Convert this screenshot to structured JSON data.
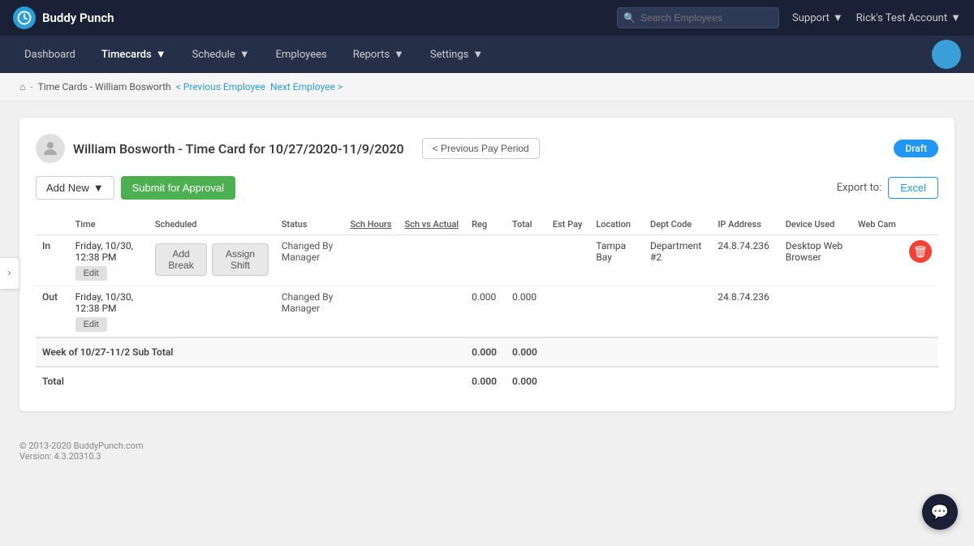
{
  "topbar": {
    "logo_text": "Buddy Punch",
    "search_placeholder": "Search Employees",
    "support_label": "Support",
    "account_name": "Rick's Test Account"
  },
  "nav": {
    "items": [
      {
        "id": "dashboard",
        "label": "Dashboard",
        "active": false,
        "has_dropdown": false
      },
      {
        "id": "timecards",
        "label": "Timecards",
        "active": true,
        "has_dropdown": true
      },
      {
        "id": "schedule",
        "label": "Schedule",
        "active": false,
        "has_dropdown": true
      },
      {
        "id": "employees",
        "label": "Employees",
        "active": false,
        "has_dropdown": false
      },
      {
        "id": "reports",
        "label": "Reports",
        "active": false,
        "has_dropdown": true
      },
      {
        "id": "settings",
        "label": "Settings",
        "active": false,
        "has_dropdown": true
      }
    ]
  },
  "breadcrumb": {
    "home_icon": "home",
    "separator": "-",
    "section": "Time Cards - William Bosworth",
    "prev_employee": "< Previous Employee",
    "next_employee": "Next Employee >"
  },
  "card": {
    "title": "William Bosworth - Time Card for 10/27/2020-11/9/2020",
    "prev_pay_period": "< Previous Pay Period",
    "status_badge": "Draft"
  },
  "toolbar": {
    "add_new_label": "Add New",
    "submit_label": "Submit for Approval",
    "export_label": "Export to:",
    "excel_label": "Excel"
  },
  "table": {
    "columns": [
      {
        "id": "in-out",
        "label": ""
      },
      {
        "id": "time",
        "label": "Time"
      },
      {
        "id": "scheduled",
        "label": "Scheduled"
      },
      {
        "id": "status",
        "label": "Status"
      },
      {
        "id": "sch-hours",
        "label": "Sch Hours",
        "underlined": true
      },
      {
        "id": "sch-vs-actual",
        "label": "Sch vs Actual",
        "underlined": true
      },
      {
        "id": "reg",
        "label": "Reg"
      },
      {
        "id": "total",
        "label": "Total"
      },
      {
        "id": "est-pay",
        "label": "Est Pay"
      },
      {
        "id": "location",
        "label": "Location"
      },
      {
        "id": "dept-code",
        "label": "Dept Code"
      },
      {
        "id": "ip-address",
        "label": "IP Address"
      },
      {
        "id": "device-used",
        "label": "Device Used"
      },
      {
        "id": "webcam",
        "label": "Web Cam"
      },
      {
        "id": "delete",
        "label": ""
      }
    ],
    "punch_rows": [
      {
        "type": "In",
        "time": "Friday, 10/30, 12:38 PM",
        "scheduled_break_label": "Add Break",
        "scheduled_assign_label": "Assign Shift",
        "status": "Changed By Manager",
        "sch_hours": "",
        "sch_vs_actual": "",
        "reg": "",
        "total": "",
        "est_pay": "",
        "location": "Tampa Bay",
        "dept_code": "Department #2",
        "ip_address": "24.8.74.236",
        "device_used": "Desktop Web Browser",
        "webcam": "",
        "show_delete": true
      },
      {
        "type": "Out",
        "time": "Friday, 10/30, 12:38 PM",
        "status": "Changed By Manager",
        "sch_hours": "",
        "sch_vs_actual": "",
        "reg": "0.000",
        "total": "0.000",
        "est_pay": "",
        "location": "",
        "dept_code": "",
        "ip_address": "24.8.74.236",
        "device_used": "",
        "webcam": "",
        "show_delete": false
      }
    ],
    "subtotal": {
      "label": "Week of 10/27-11/2 Sub Total",
      "reg": "0.000",
      "total": "0.000"
    },
    "total_row": {
      "label": "Total",
      "reg": "0.000",
      "total": "0.000"
    }
  },
  "footer": {
    "copyright": "© 2013-2020 BuddyPunch.com",
    "version": "Version: 4.3.20310.3"
  }
}
